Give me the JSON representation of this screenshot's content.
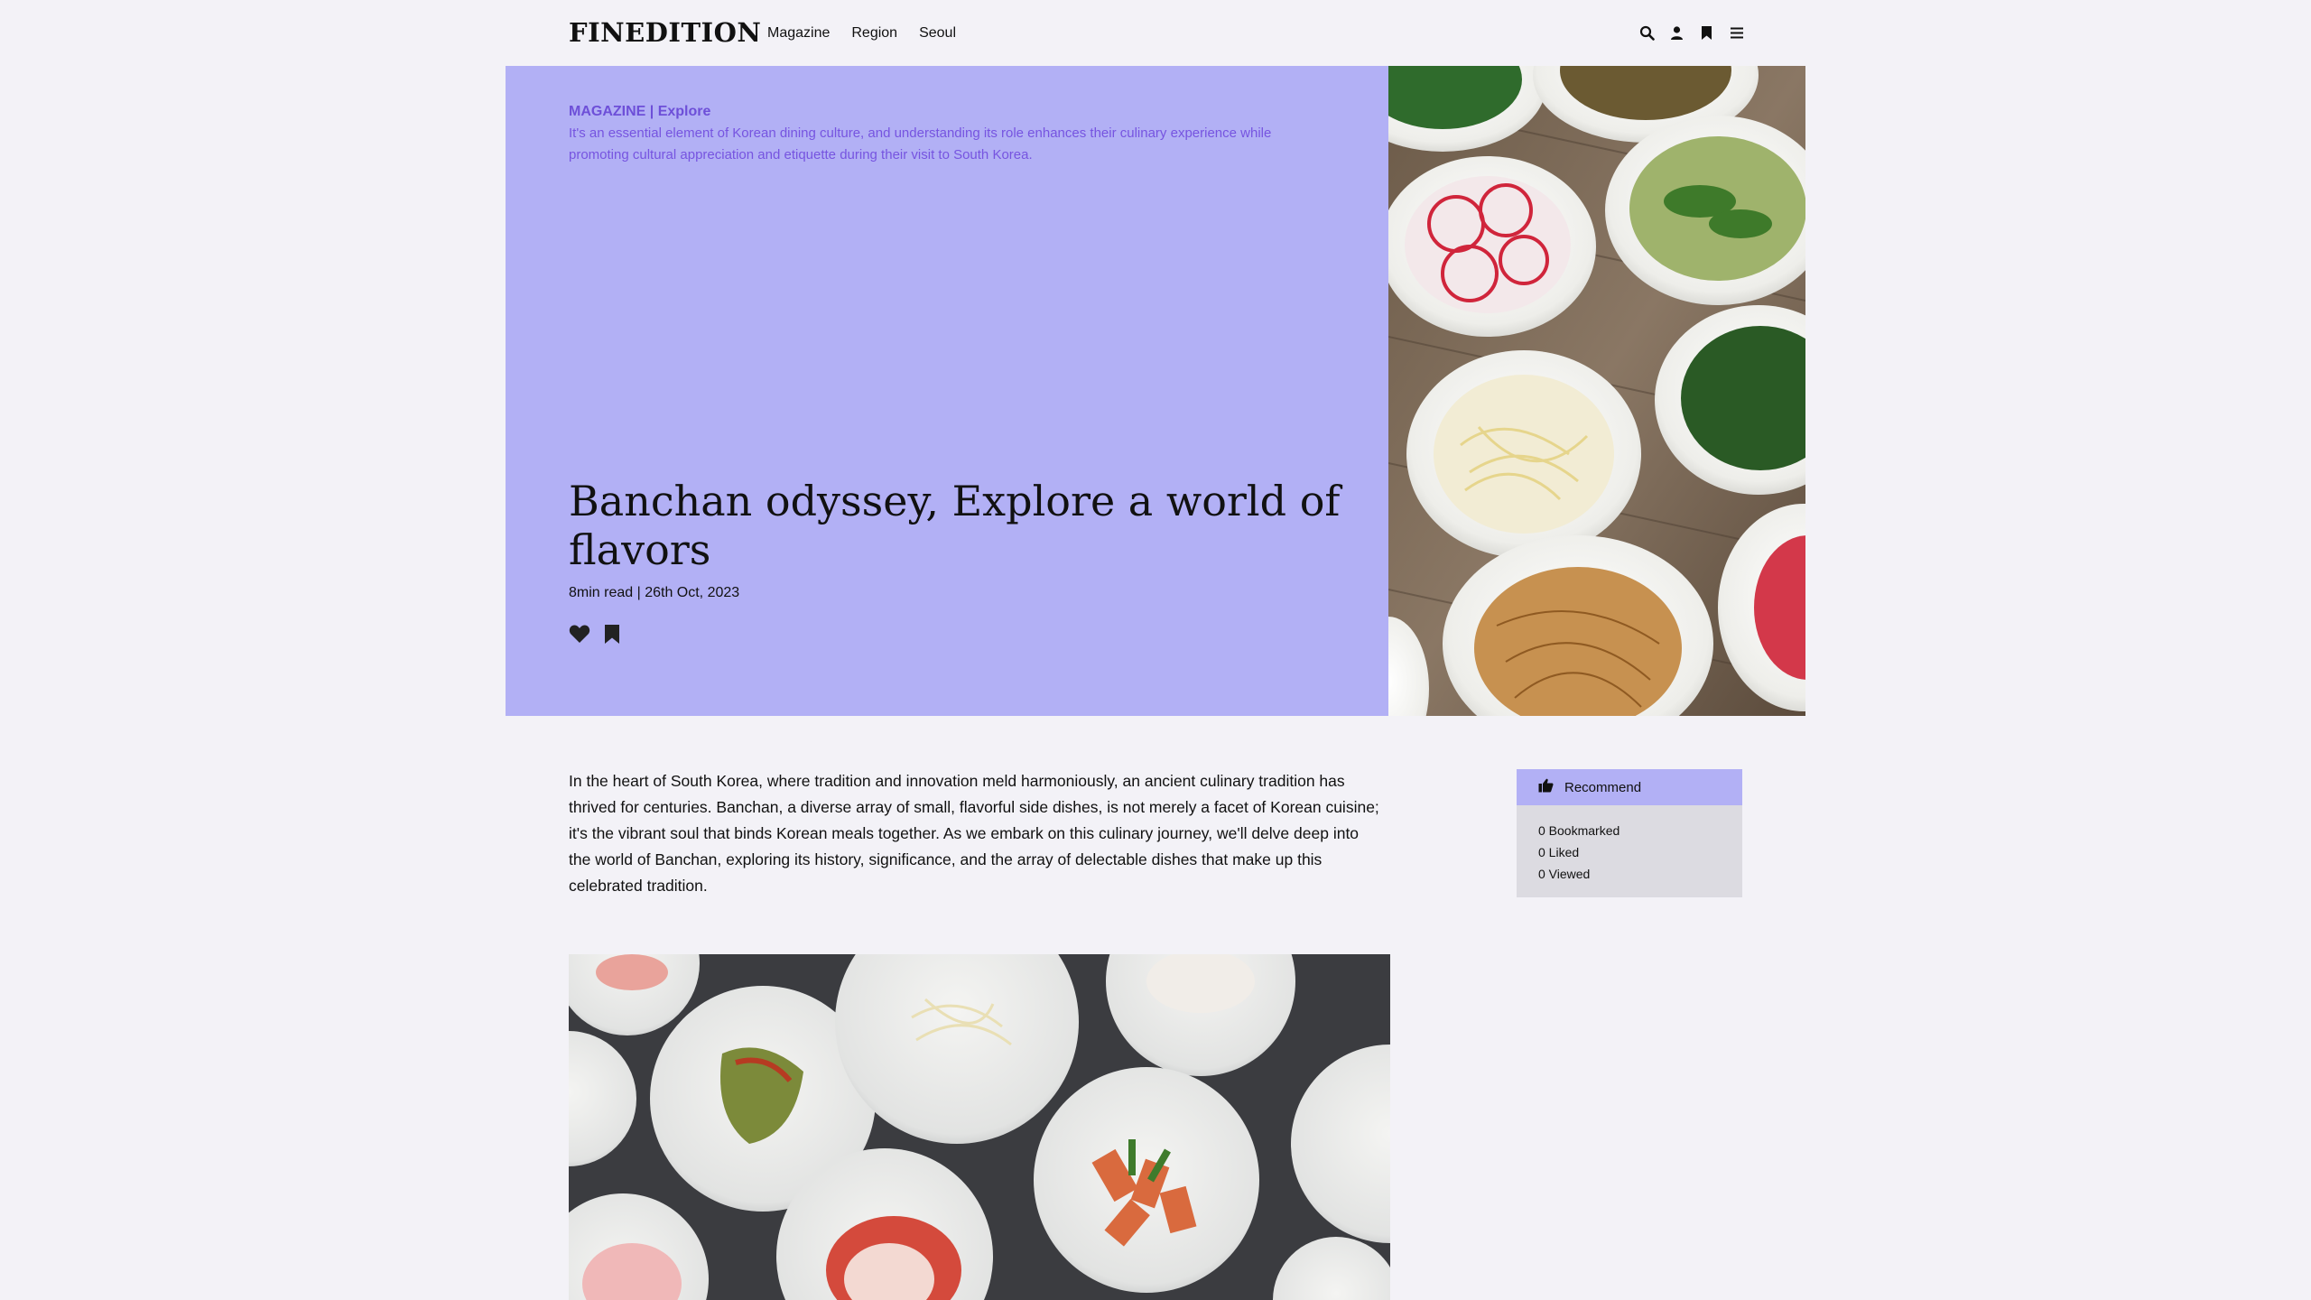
{
  "header": {
    "logo": "FINEDITION",
    "nav": [
      "Magazine",
      "Region",
      "Seoul"
    ],
    "icons": [
      "search-icon",
      "user-icon",
      "bookmark-icon",
      "menu-icon"
    ]
  },
  "hero": {
    "kicker": "MAGAZINE | Explore",
    "summary": "It's an essential element of Korean dining culture, and understanding its role enhances their culinary experience while promoting cultural appreciation and etiquette during their visit to South Korea.",
    "title": "Banchan odyssey, Explore a world of flavors",
    "meta": "8min read | 26th Oct, 2023",
    "background_color": "#b2b0f5",
    "actions": [
      "heart-icon",
      "bookmark-icon"
    ]
  },
  "article": {
    "intro": "In the heart of South Korea, where tradition and innovation meld harmoniously, an ancient culinary tradition has thrived for centuries. Banchan, a diverse array of small, flavorful side dishes, is not merely a facet of Korean cuisine; it's the vibrant soul that binds Korean meals together. As we embark on this culinary journey, we'll delve deep into the world of Banchan, exploring its history, significance, and the array of delectable dishes that make up this celebrated tradition."
  },
  "sidebar": {
    "recommend_label": "Recommend",
    "stats": {
      "bookmarked": "0 Bookmarked",
      "liked": "0 Liked",
      "viewed": "0 Viewed"
    }
  }
}
